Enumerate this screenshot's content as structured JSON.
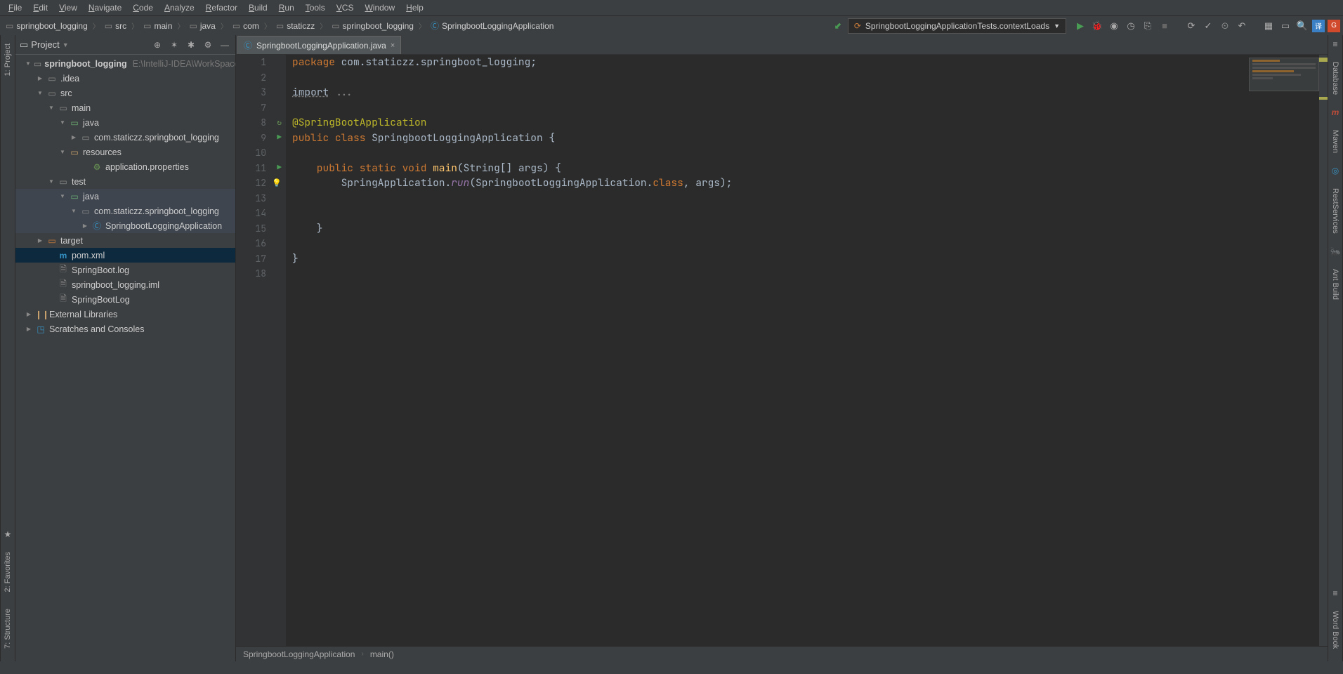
{
  "menu": [
    "File",
    "Edit",
    "View",
    "Navigate",
    "Code",
    "Analyze",
    "Refactor",
    "Build",
    "Run",
    "Tools",
    "VCS",
    "Window",
    "Help"
  ],
  "breadcrumb": [
    {
      "label": "springboot_logging",
      "icon": "module"
    },
    {
      "label": "src",
      "icon": "folder"
    },
    {
      "label": "main",
      "icon": "folder"
    },
    {
      "label": "java",
      "icon": "folder"
    },
    {
      "label": "com",
      "icon": "folder"
    },
    {
      "label": "staticzz",
      "icon": "folder"
    },
    {
      "label": "springboot_logging",
      "icon": "folder"
    },
    {
      "label": "SpringbootLoggingApplication",
      "icon": "class"
    }
  ],
  "runConfig": "SpringbootLoggingApplicationTests.contextLoads",
  "projectPanel": {
    "title": "Project"
  },
  "tree": {
    "root": {
      "name": "springboot_logging",
      "path": "E:\\IntelliJ-IDEA\\WorkSpace"
    },
    "idea": ".idea",
    "src": "src",
    "main": "main",
    "java": "java",
    "pkg": "com.staticzz.springboot_logging",
    "resources": "resources",
    "appprops": "application.properties",
    "test": "test",
    "testjava": "java",
    "testpkg": "com.staticzz.springboot_logging",
    "appclass": "SpringbootLoggingApplication",
    "target": "target",
    "pom": "pom.xml",
    "log1": "SpringBoot.log",
    "iml": "springboot_logging.iml",
    "log2": "SpringBootLog",
    "extlib": "External Libraries",
    "scratch": "Scratches and Consoles"
  },
  "tab": {
    "name": "SpringbootLoggingApplication.java"
  },
  "lineNums": [
    1,
    2,
    3,
    7,
    8,
    9,
    10,
    11,
    12,
    13,
    14,
    15,
    16,
    17,
    18
  ],
  "code": {
    "l1_kw": "package",
    "l1_pkg": " com.staticzz.springboot_logging",
    "l3_kw": "import",
    "l3_rest": " ...",
    "l8": "@SpringBootApplication",
    "l9_kw": "public class ",
    "l9_cls": "SpringbootLoggingApplication",
    "l9_end": " {",
    "l11_kw": "    public static void ",
    "l11_mth": "main",
    "l11_args": "(String[] args) {",
    "l12_a": "        SpringApplication.",
    "l12_run": "run",
    "l12_b": "(SpringbootLoggingApplication.",
    "l12_cls": "class",
    "l12_c": ", args);",
    "l15": "    }",
    "l17": "}"
  },
  "editorCrumb": [
    "SpringbootLoggingApplication",
    "main()"
  ],
  "leftStripe": [
    "1: Project",
    "2: Favorites",
    "7: Structure"
  ],
  "rightStripe": [
    "Database",
    "Maven",
    "RestServices",
    "Ant Build",
    "Word Book"
  ]
}
